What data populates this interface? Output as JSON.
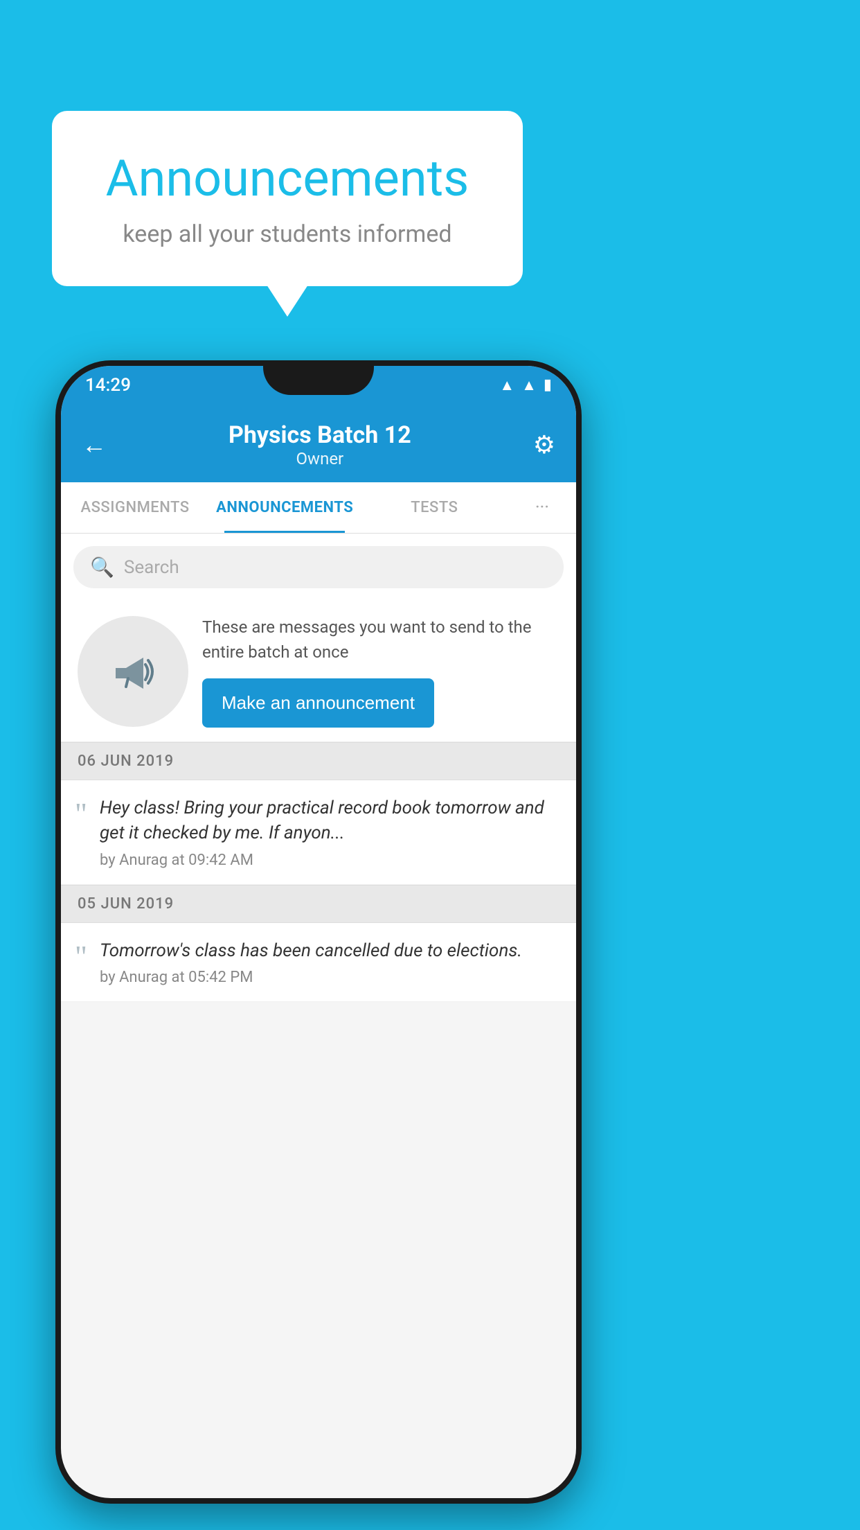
{
  "background_color": "#1bbde8",
  "speech_bubble": {
    "title": "Announcements",
    "subtitle": "keep all your students informed"
  },
  "phone": {
    "status_bar": {
      "time": "14:29",
      "icons": [
        "wifi",
        "signal",
        "battery"
      ]
    },
    "header": {
      "title": "Physics Batch 12",
      "subtitle": "Owner",
      "back_label": "←",
      "gear_label": "⚙"
    },
    "tabs": [
      {
        "label": "ASSIGNMENTS",
        "active": false
      },
      {
        "label": "ANNOUNCEMENTS",
        "active": true
      },
      {
        "label": "TESTS",
        "active": false
      },
      {
        "label": "···",
        "active": false
      }
    ],
    "search": {
      "placeholder": "Search"
    },
    "promo": {
      "description": "These are messages you want to send to the entire batch at once",
      "button_label": "Make an announcement"
    },
    "announcements": [
      {
        "date": "06  JUN  2019",
        "text": "Hey class! Bring your practical record book tomorrow and get it checked by me. If anyon...",
        "meta": "by Anurag at 09:42 AM"
      },
      {
        "date": "05  JUN  2019",
        "text": "Tomorrow's class has been cancelled due to elections.",
        "meta": "by Anurag at 05:42 PM"
      }
    ]
  }
}
